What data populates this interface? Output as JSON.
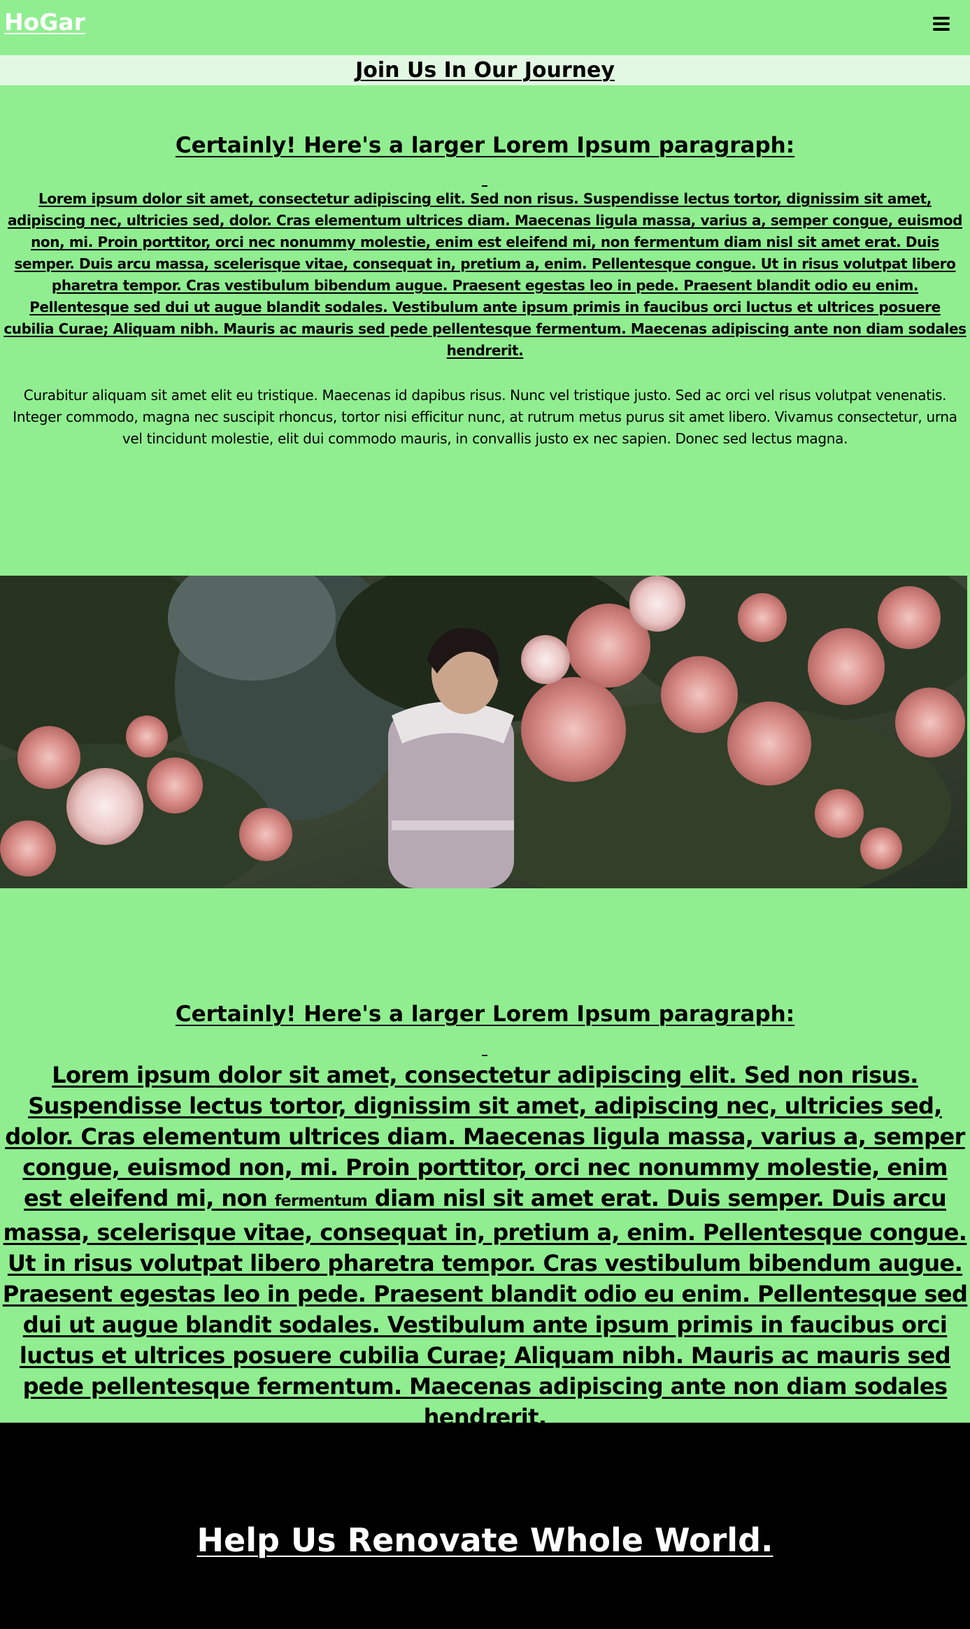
{
  "header": {
    "brand": "HoGar",
    "menu_icon": "hamburger-menu-icon"
  },
  "banner": {
    "title": "Join Us In Our Journey"
  },
  "section1": {
    "heading": "Certainly! Here's a larger Lorem Ipsum paragraph:",
    "paragraph_main": "Lorem ipsum dolor sit amet, consectetur adipiscing elit. Sed non risus. Suspendisse lectus tortor, dignissim sit amet, adipiscing nec, ultricies sed, dolor. Cras elementum ultrices diam. Maecenas ligula massa, varius a, semper congue, euismod non, mi. Proin porttitor, orci nec nonummy molestie, enim est eleifend mi, non fermentum diam nisl sit amet erat. Duis semper. Duis arcu massa, scelerisque vitae, consequat in, pretium a, enim. Pellentesque congue. Ut in risus volutpat libero pharetra tempor. Cras vestibulum bibendum augue. Praesent egestas leo in pede. Praesent blandit odio eu enim. Pellentesque sed dui ut augue blandit sodales. Vestibulum ante ipsum primis in faucibus orci luctus et ultrices posuere cubilia Curae; Aliquam nibh. Mauris ac mauris sed pede pellentesque fermentum. Maecenas adipiscing ante non diam sodales hendrerit.",
    "paragraph_secondary": "Curabitur aliquam sit amet elit eu tristique. Maecenas id dapibus risus. Nunc vel tristique justo. Sed ac orci vel risus volutpat venenatis. Integer commodo, magna nec suscipit rhoncus, tortor nisi efficitur nunc, at rutrum metus purus sit amet libero. Vivamus consectetur, urna vel tincidunt molestie, elit dui commodo mauris, in convallis justo ex nec sapien. Donec sed lectus magna."
  },
  "section2": {
    "heading": "Certainly! Here's a larger Lorem Ipsum paragraph:",
    "paragraph_before": "Lorem ipsum dolor sit amet, consectetur adipiscing elit. Sed non risus. Suspendisse lectus tortor, dignissim sit amet, adipiscing nec, ultricies sed, dolor. Cras elementum ultrices diam. Maecenas ligula massa, varius a, semper congue, euismod non, mi. Proin porttitor, orci nec nonummy molestie, enim est eleifend mi, non ",
    "paragraph_small": "fermentum",
    "paragraph_after": " diam nisl sit amet erat. Duis semper. Duis arcu massa, scelerisque vitae, consequat in, pretium a, enim. Pellentesque congue. Ut in risus volutpat libero pharetra tempor. Cras vestibulum bibendum augue. Praesent egestas leo in pede. Praesent blandit odio eu enim. Pellentesque sed dui ut augue blandit sodales. Vestibulum ante ipsum primis in faucibus orci luctus et ultrices posuere cubilia Curae; Aliquam nibh. Mauris ac mauris sed pede pellentesque fermentum. Maecenas adipiscing ante non diam sodales hendrerit."
  },
  "footer": {
    "title": "Help Us Renovate Whole World."
  },
  "colors": {
    "page_background": "#90ee90",
    "banner_background": "#e2f8e2",
    "footer_background": "#000000",
    "brand_text": "#ffffff"
  }
}
